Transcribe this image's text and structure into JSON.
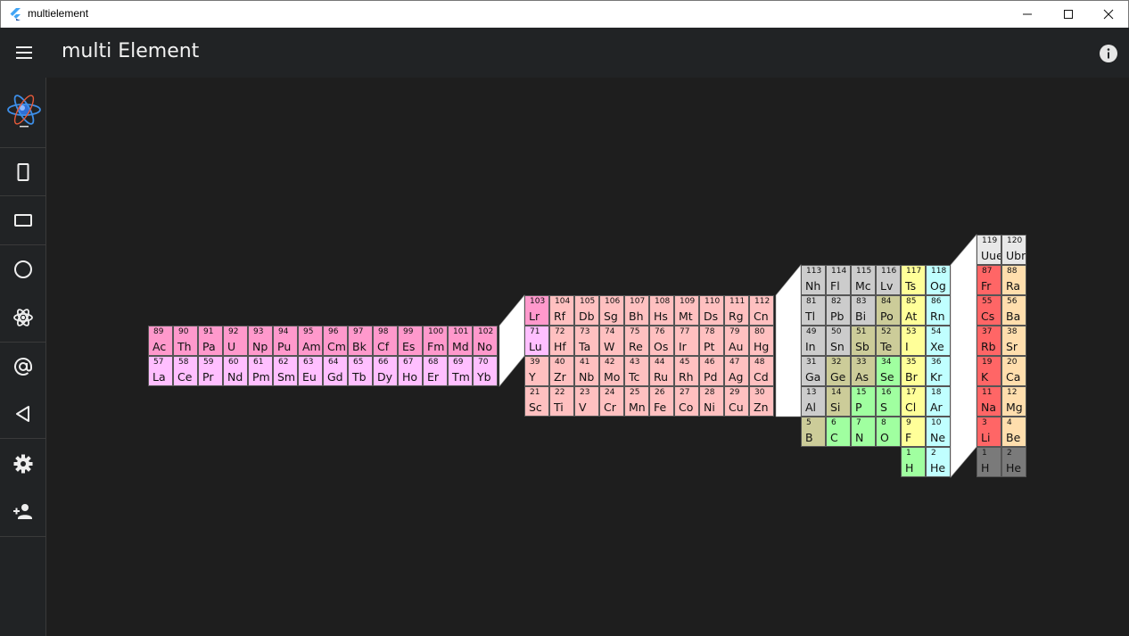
{
  "window": {
    "title": "multielement",
    "controls": {
      "minimize": "—",
      "maximize": "☐",
      "close": "✕"
    }
  },
  "appbar": {
    "title": "multi Element",
    "info_icon": "info-icon",
    "menu_icon": "menu-icon"
  },
  "colors": {
    "background": "#1e1e1e",
    "bars": "#212325",
    "actinide": "#ff99cc",
    "lanthanide": "#ffbfff",
    "transition": "#ffc0c0",
    "post_transition": "#cccccc",
    "metalloid": "#cccc99",
    "nonmetal": "#a0ffa0",
    "halogen": "#ffff99",
    "noble_gas": "#c0ffff",
    "alkali": "#ff6666",
    "alkaline": "#ffdead",
    "unknown": "#e8e8e8",
    "hydrogen_alt": "#7a7a7a",
    "connector": "#ffffff"
  },
  "rail": [
    {
      "icon": "phone-portrait-icon"
    },
    {
      "icon": "phone-landscape-icon"
    },
    {
      "icon": "circle-icon"
    },
    {
      "icon": "atom-icon"
    },
    {
      "icon": "at-icon"
    },
    {
      "icon": "back-triangle-icon"
    },
    {
      "icon": "gear-icon"
    },
    {
      "icon": "add-user-icon"
    }
  ],
  "table": {
    "actinides": [
      [
        "89",
        "Ac"
      ],
      [
        "90",
        "Th"
      ],
      [
        "91",
        "Pa"
      ],
      [
        "92",
        "U"
      ],
      [
        "93",
        "Np"
      ],
      [
        "94",
        "Pu"
      ],
      [
        "95",
        "Am"
      ],
      [
        "96",
        "Cm"
      ],
      [
        "97",
        "Bk"
      ],
      [
        "98",
        "Cf"
      ],
      [
        "99",
        "Es"
      ],
      [
        "100",
        "Fm"
      ],
      [
        "101",
        "Md"
      ],
      [
        "102",
        "No"
      ]
    ],
    "lanthanides": [
      [
        "57",
        "La"
      ],
      [
        "58",
        "Ce"
      ],
      [
        "59",
        "Pr"
      ],
      [
        "60",
        "Nd"
      ],
      [
        "61",
        "Pm"
      ],
      [
        "62",
        "Sm"
      ],
      [
        "63",
        "Eu"
      ],
      [
        "64",
        "Gd"
      ],
      [
        "65",
        "Tb"
      ],
      [
        "66",
        "Dy"
      ],
      [
        "67",
        "Ho"
      ],
      [
        "68",
        "Er"
      ],
      [
        "69",
        "Tm"
      ],
      [
        "70",
        "Yb"
      ]
    ],
    "d_col0": [
      [
        "103",
        "Lr"
      ],
      [
        "71",
        "Lu"
      ],
      [
        "39",
        "Y"
      ],
      [
        "21",
        "Sc"
      ]
    ],
    "d_rows": [
      [
        [
          "104",
          "Rf"
        ],
        [
          "105",
          "Db"
        ],
        [
          "106",
          "Sg"
        ],
        [
          "107",
          "Bh"
        ],
        [
          "108",
          "Hs"
        ],
        [
          "109",
          "Mt"
        ],
        [
          "110",
          "Ds"
        ],
        [
          "111",
          "Rg"
        ],
        [
          "112",
          "Cn"
        ]
      ],
      [
        [
          "72",
          "Hf"
        ],
        [
          "73",
          "Ta"
        ],
        [
          "74",
          "W"
        ],
        [
          "75",
          "Re"
        ],
        [
          "76",
          "Os"
        ],
        [
          "77",
          "Ir"
        ],
        [
          "78",
          "Pt"
        ],
        [
          "79",
          "Au"
        ],
        [
          "80",
          "Hg"
        ]
      ],
      [
        [
          "40",
          "Zr"
        ],
        [
          "41",
          "Nb"
        ],
        [
          "42",
          "Mo"
        ],
        [
          "43",
          "Tc"
        ],
        [
          "44",
          "Ru"
        ],
        [
          "45",
          "Rh"
        ],
        [
          "46",
          "Pd"
        ],
        [
          "47",
          "Ag"
        ],
        [
          "48",
          "Cd"
        ]
      ],
      [
        [
          "22",
          "Ti"
        ],
        [
          "23",
          "V"
        ],
        [
          "24",
          "Cr"
        ],
        [
          "25",
          "Mn"
        ],
        [
          "26",
          "Fe"
        ],
        [
          "27",
          "Co"
        ],
        [
          "28",
          "Ni"
        ],
        [
          "29",
          "Cu"
        ],
        [
          "30",
          "Zn"
        ]
      ]
    ],
    "p_rows": [
      [
        [
          "113",
          "Nh"
        ],
        [
          "114",
          "Fl"
        ],
        [
          "115",
          "Mc"
        ],
        [
          "116",
          "Lv"
        ]
      ],
      [
        [
          "81",
          "Tl"
        ],
        [
          "82",
          "Pb"
        ],
        [
          "83",
          "Bi"
        ],
        [
          "84",
          "Po"
        ]
      ],
      [
        [
          "49",
          "In"
        ],
        [
          "50",
          "Sn"
        ],
        [
          "51",
          "Sb"
        ],
        [
          "52",
          "Te"
        ]
      ],
      [
        [
          "31",
          "Ga"
        ],
        [
          "32",
          "Ge"
        ],
        [
          "33",
          "As"
        ],
        [
          "34",
          "Se"
        ]
      ],
      [
        [
          "13",
          "Al"
        ],
        [
          "14",
          "Si"
        ],
        [
          "15",
          "P"
        ],
        [
          "16",
          "S"
        ]
      ],
      [
        [
          "5",
          "B"
        ],
        [
          "6",
          "C"
        ],
        [
          "7",
          "N"
        ],
        [
          "8",
          "O"
        ]
      ]
    ],
    "p_cats": [
      [
        "post_transition",
        "post_transition",
        "post_transition",
        "post_transition"
      ],
      [
        "post_transition",
        "post_transition",
        "post_transition",
        "metalloid"
      ],
      [
        "post_transition",
        "post_transition",
        "metalloid",
        "metalloid"
      ],
      [
        "post_transition",
        "metalloid",
        "metalloid",
        "nonmetal"
      ],
      [
        "post_transition",
        "metalloid",
        "nonmetal",
        "nonmetal"
      ],
      [
        "metalloid",
        "nonmetal",
        "nonmetal",
        "nonmetal"
      ]
    ],
    "halogens": [
      [
        "117",
        "Ts"
      ],
      [
        "85",
        "At"
      ],
      [
        "53",
        "I"
      ],
      [
        "35",
        "Br"
      ],
      [
        "17",
        "Cl"
      ],
      [
        "9",
        "F"
      ],
      [
        "1",
        "H"
      ]
    ],
    "nobles": [
      [
        "118",
        "Og"
      ],
      [
        "86",
        "Rn"
      ],
      [
        "54",
        "Xe"
      ],
      [
        "36",
        "Kr"
      ],
      [
        "18",
        "Ar"
      ],
      [
        "10",
        "Ne"
      ],
      [
        "2",
        "He"
      ]
    ],
    "s_top": [
      [
        "119",
        "Uue"
      ],
      [
        "120",
        "Ubn"
      ]
    ],
    "s_rows": [
      [
        [
          "87",
          "Fr"
        ],
        [
          "88",
          "Ra"
        ]
      ],
      [
        [
          "55",
          "Cs"
        ],
        [
          "56",
          "Ba"
        ]
      ],
      [
        [
          "37",
          "Rb"
        ],
        [
          "38",
          "Sr"
        ]
      ],
      [
        [
          "19",
          "K"
        ],
        [
          "20",
          "Ca"
        ]
      ],
      [
        [
          "11",
          "Na"
        ],
        [
          "12",
          "Mg"
        ]
      ],
      [
        [
          "3",
          "Li"
        ],
        [
          "4",
          "Be"
        ]
      ],
      [
        [
          "1",
          "H"
        ],
        [
          "2",
          "He"
        ]
      ]
    ]
  }
}
